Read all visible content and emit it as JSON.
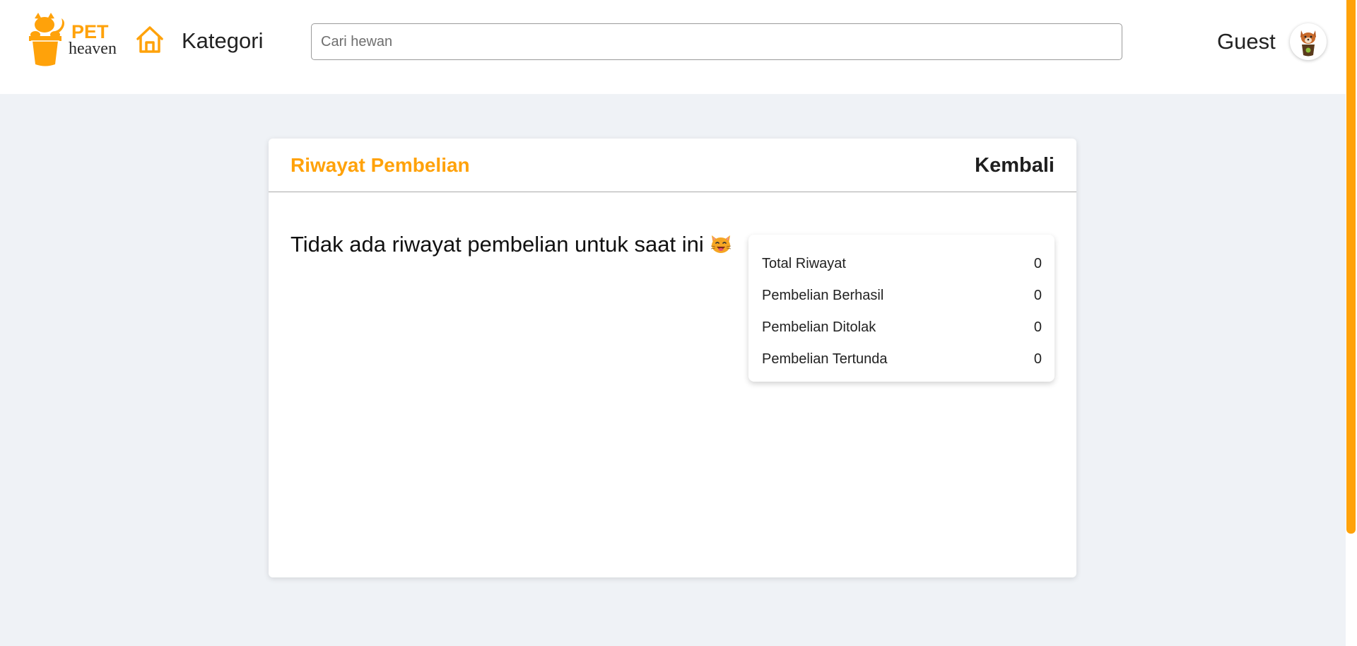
{
  "header": {
    "logo": {
      "primary": "PET",
      "secondary": "heaven",
      "icon": "cat-in-pot-logo"
    },
    "home_icon": "home-icon",
    "kategori_label": "Kategori",
    "search": {
      "placeholder": "Cari hewan",
      "value": ""
    },
    "user_label": "Guest",
    "avatar_icon": "dog-avatar-icon"
  },
  "main": {
    "title": "Riwayat Pembelian",
    "back_label": "Kembali",
    "empty_message": "Tidak ada riwayat pembelian untuk saat ini",
    "empty_emoji": "cat-face-icon",
    "stats": [
      {
        "label": "Total Riwayat",
        "value": "0"
      },
      {
        "label": "Pembelian Berhasil",
        "value": "0"
      },
      {
        "label": "Pembelian Ditolak",
        "value": "0"
      },
      {
        "label": "Pembelian Tertunda",
        "value": "0"
      }
    ]
  },
  "colors": {
    "accent": "#ffa20a",
    "page_background": "#eff2f6",
    "card_background": "#ffffff"
  }
}
